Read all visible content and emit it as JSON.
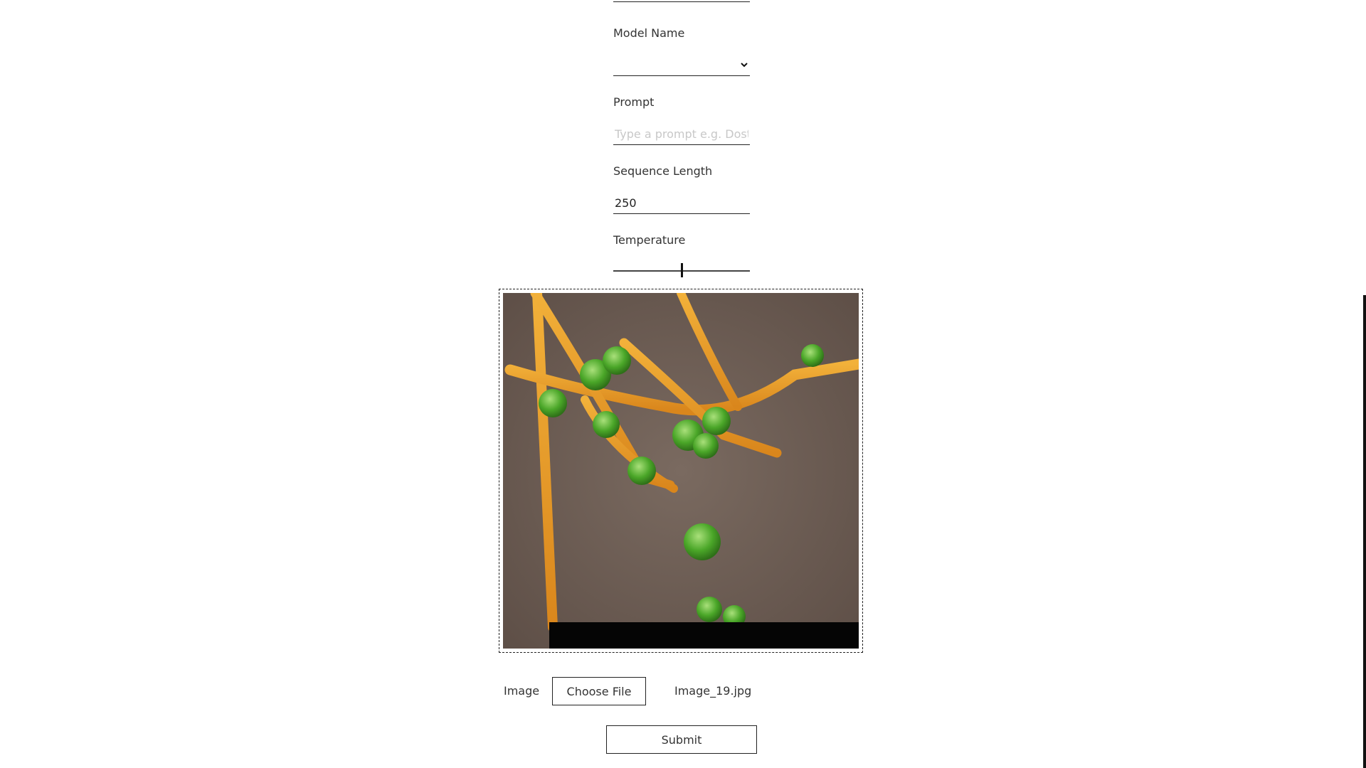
{
  "form": {
    "model_name": {
      "label": "Model Name",
      "value": ""
    },
    "prompt": {
      "label": "Prompt",
      "placeholder": "Type a prompt e.g. Dostoevsky",
      "value": ""
    },
    "sequence_length": {
      "label": "Sequence Length",
      "value": "250"
    },
    "temperature": {
      "label": "Temperature",
      "value_fraction": 0.5
    },
    "image": {
      "label": "Image",
      "choose_label": "Choose File",
      "file_name": "Image_19.jpg"
    },
    "submit_label": "Submit"
  },
  "icons": {
    "select_chevron": "chevron-down-icon"
  },
  "colors": {
    "background": "#ffffff",
    "border": "#222222",
    "text": "#333333",
    "placeholder": "#c8c8c8"
  }
}
